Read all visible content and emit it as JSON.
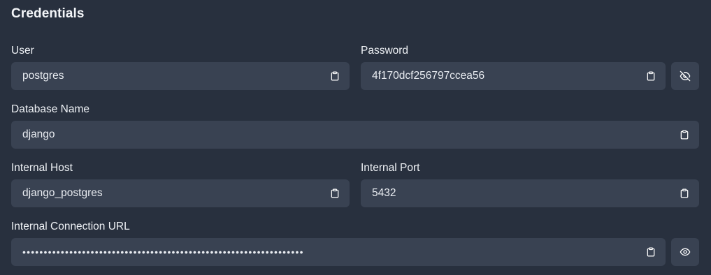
{
  "title": "Credentials",
  "user": {
    "label": "User",
    "value": "postgres",
    "copy_icon": "clipboard-icon"
  },
  "password": {
    "label": "Password",
    "value": "4f170dcf256797ccea56",
    "copy_icon": "clipboard-icon",
    "toggle_icon": "eye-off-icon"
  },
  "database_name": {
    "label": "Database Name",
    "value": "django",
    "copy_icon": "clipboard-icon"
  },
  "internal_host": {
    "label": "Internal Host",
    "value": "django_postgres",
    "copy_icon": "clipboard-icon"
  },
  "internal_port": {
    "label": "Internal Port",
    "value": "5432",
    "copy_icon": "clipboard-icon"
  },
  "internal_connection_url": {
    "label": "Internal Connection URL",
    "value": "••••••••••••••••••••••••••••••••••••••••••••••••••••••••••••••••••",
    "copy_icon": "clipboard-icon",
    "toggle_icon": "eye-icon"
  },
  "colors": {
    "background": "#28303e",
    "field_background": "#394252",
    "text": "#eef1f5"
  }
}
